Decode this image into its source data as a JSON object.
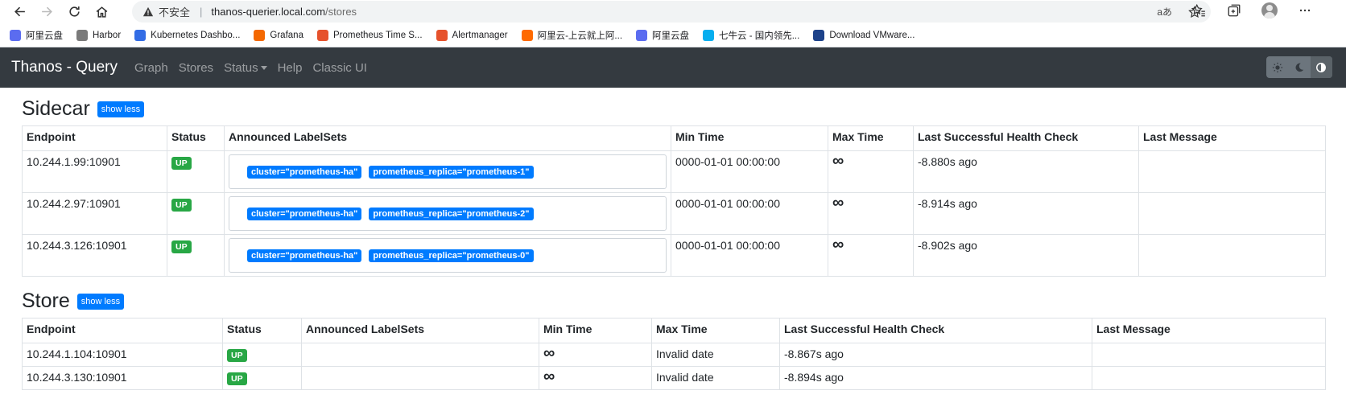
{
  "browser": {
    "insecure_label": "不安全",
    "url_host": "thanos-querier.local.com",
    "url_path": "/stores",
    "read_aloud": "aあ"
  },
  "bookmarks": [
    {
      "label": "阿里云盘",
      "color": "#5b6cf0"
    },
    {
      "label": "Harbor",
      "color": "#7a7a7a"
    },
    {
      "label": "Kubernetes Dashbo...",
      "color": "#326ce5"
    },
    {
      "label": "Grafana",
      "color": "#f46800"
    },
    {
      "label": "Prometheus Time S...",
      "color": "#e6522c"
    },
    {
      "label": "Alertmanager",
      "color": "#e6522c"
    },
    {
      "label": "阿里云-上云就上阿...",
      "color": "#ff6a00"
    },
    {
      "label": "阿里云盘",
      "color": "#5b6cf0"
    },
    {
      "label": "七牛云 - 国内领先...",
      "color": "#06aeef"
    },
    {
      "label": "Download VMware...",
      "color": "#1d428a"
    }
  ],
  "navbar": {
    "brand": "Thanos - Query",
    "links": [
      "Graph",
      "Stores",
      "Status",
      "Help",
      "Classic UI"
    ]
  },
  "sidecar": {
    "title": "Sidecar",
    "toggle": "show less",
    "headers": [
      "Endpoint",
      "Status",
      "Announced LabelSets",
      "Min Time",
      "Max Time",
      "Last Successful Health Check",
      "Last Message"
    ],
    "rows": [
      {
        "endpoint": "10.244.1.99:10901",
        "status": "UP",
        "labels": [
          "cluster=\"prometheus-ha\"",
          "prometheus_replica=\"prometheus-1\""
        ],
        "min_time": "0000-01-01 00:00:00",
        "max_time": "∞",
        "health": "-8.880s ago",
        "message": ""
      },
      {
        "endpoint": "10.244.2.97:10901",
        "status": "UP",
        "labels": [
          "cluster=\"prometheus-ha\"",
          "prometheus_replica=\"prometheus-2\""
        ],
        "min_time": "0000-01-01 00:00:00",
        "max_time": "∞",
        "health": "-8.914s ago",
        "message": ""
      },
      {
        "endpoint": "10.244.3.126:10901",
        "status": "UP",
        "labels": [
          "cluster=\"prometheus-ha\"",
          "prometheus_replica=\"prometheus-0\""
        ],
        "min_time": "0000-01-01 00:00:00",
        "max_time": "∞",
        "health": "-8.902s ago",
        "message": ""
      }
    ]
  },
  "store": {
    "title": "Store",
    "toggle": "show less",
    "headers": [
      "Endpoint",
      "Status",
      "Announced LabelSets",
      "Min Time",
      "Max Time",
      "Last Successful Health Check",
      "Last Message"
    ],
    "rows": [
      {
        "endpoint": "10.244.1.104:10901",
        "status": "UP",
        "min_time": "∞",
        "max_time": "Invalid date",
        "health": "-8.867s ago",
        "message": ""
      },
      {
        "endpoint": "10.244.3.130:10901",
        "status": "UP",
        "min_time": "∞",
        "max_time": "Invalid date",
        "health": "-8.894s ago",
        "message": ""
      }
    ]
  },
  "colors": {
    "primary": "#007bff",
    "success": "#28a745",
    "navbar": "#343a40"
  }
}
